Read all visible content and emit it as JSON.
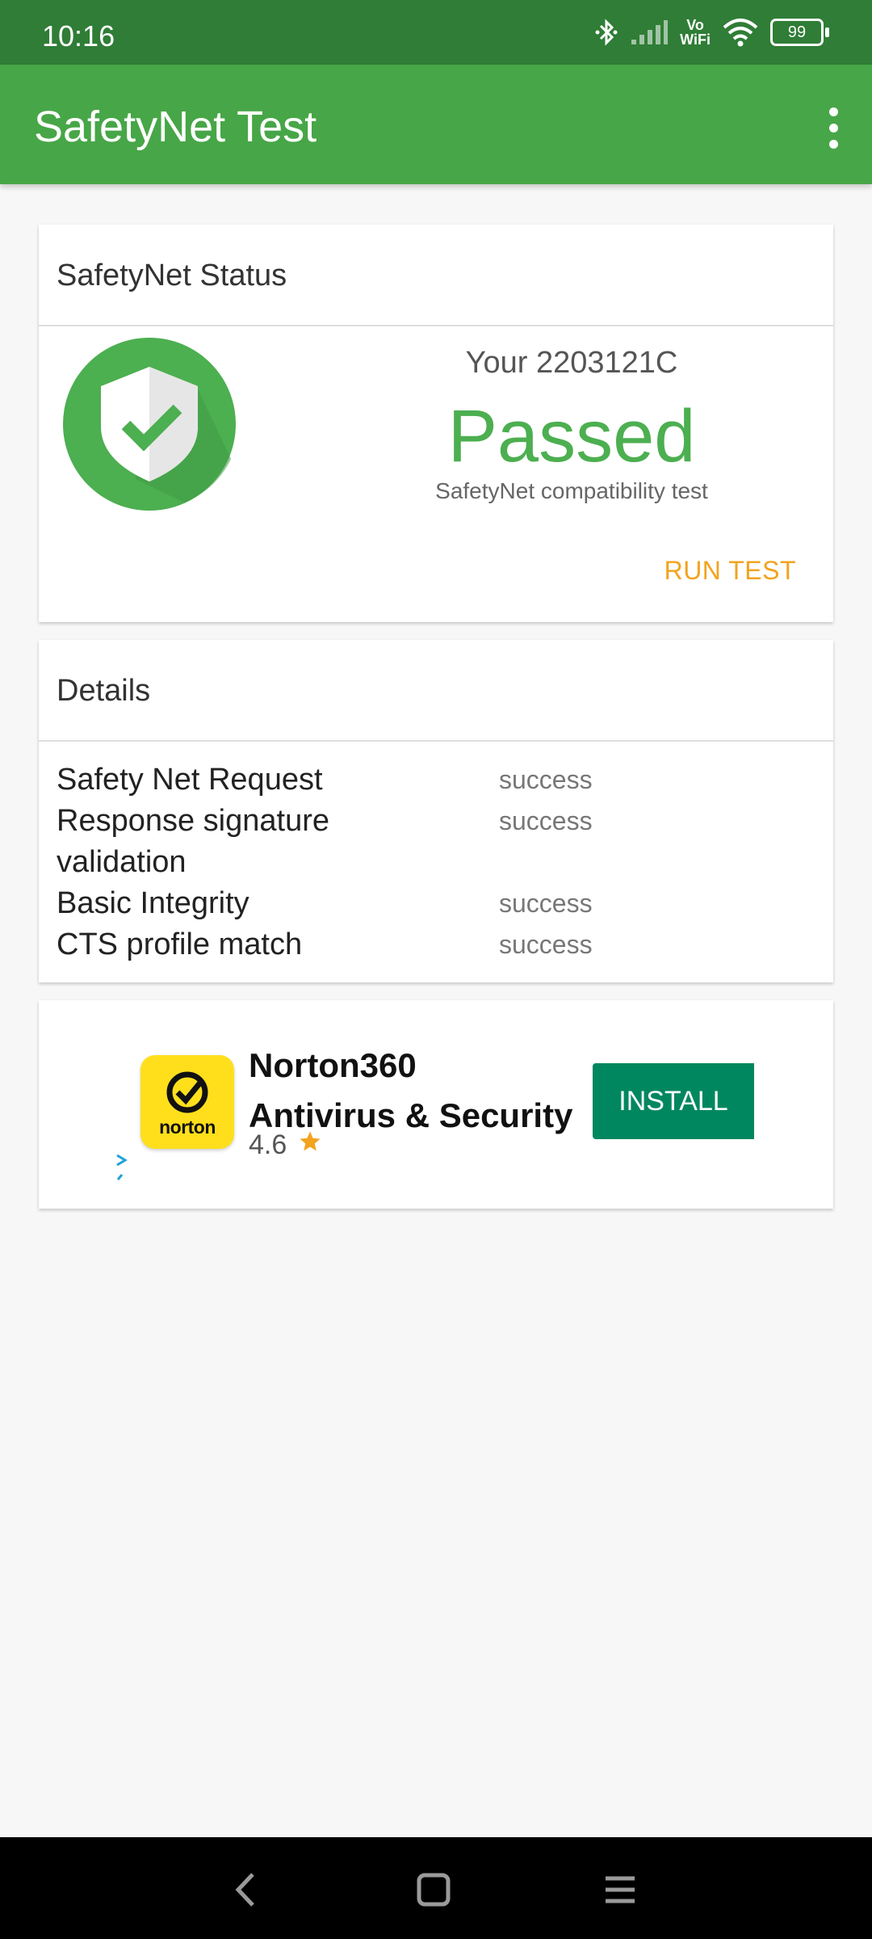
{
  "status_bar": {
    "time": "10:16",
    "battery": "99",
    "vowifi_top": "Vo",
    "vowifi_bottom": "WiFi",
    "icons": [
      "bluetooth-icon",
      "signal-icon",
      "vowifi-icon",
      "wifi-icon",
      "battery-icon"
    ]
  },
  "app_bar": {
    "title": "SafetyNet Test",
    "menu_icon": "more-vert-icon"
  },
  "status_card": {
    "header": "SafetyNet Status",
    "device_prefix": "Your",
    "device_model": "2203121C",
    "result": "Passed",
    "subtitle": "SafetyNet compatibility test",
    "run_test_label": "RUN TEST",
    "icon": "shield-check-icon"
  },
  "details_card": {
    "header": "Details",
    "rows": [
      {
        "label": "Safety Net Request",
        "value": "success"
      },
      {
        "label": "Response signature validation",
        "value": "success"
      },
      {
        "label": "Basic Integrity",
        "value": "success"
      },
      {
        "label": "CTS profile match",
        "value": "success"
      }
    ]
  },
  "ad": {
    "app_name_line1": "Norton360",
    "app_name_line2": "Antivirus & Security",
    "rating": "4.6",
    "install_label": "INSTALL",
    "icon_text": "norton"
  },
  "nav_bar": {
    "buttons": [
      "back-icon",
      "home-icon",
      "recents-icon"
    ]
  },
  "colors": {
    "status_bar": "#2f7d36",
    "app_bar": "#47a647",
    "passed": "#4caf50",
    "run_test": "#f2a31f",
    "install": "#01875f",
    "norton_yellow": "#ffdf1c"
  }
}
